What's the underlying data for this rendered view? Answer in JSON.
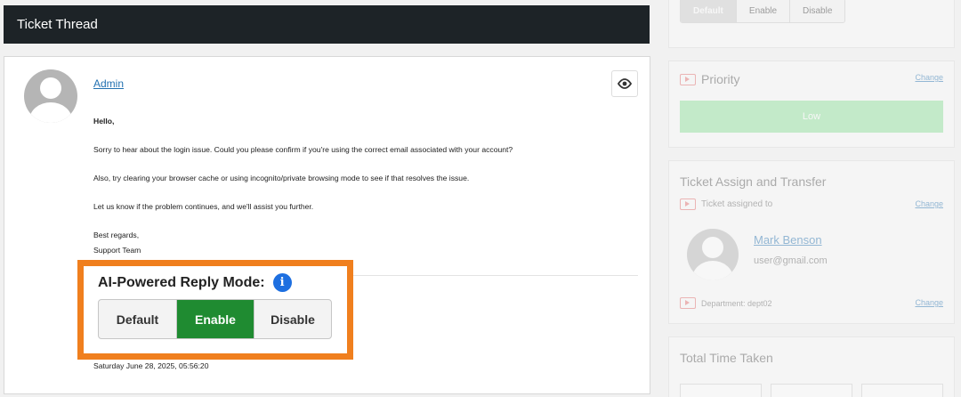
{
  "thread": {
    "header_title": "Ticket Thread",
    "author": "Admin",
    "greeting": "Hello,",
    "paragraphs": [
      "Sorry to hear about the login issue. Could you please confirm if you're using the correct email associated with your account?",
      "Also, try clearing your browser cache or using incognito/private browsing mode to see if that resolves the issue.",
      "Let us know if the problem continues, and we'll assist you further."
    ],
    "signoff": "Best regards,",
    "signature": "Support Team",
    "timestamp": "Saturday June 28, 2025, 05:56:20"
  },
  "ai_mode": {
    "title": "AI-Powered Reply Mode:",
    "info_icon": "info-icon",
    "options": [
      "Default",
      "Enable",
      "Disable"
    ],
    "selected": "Enable",
    "selected_color": "#1f8b31",
    "highlight_color": "#f07f1e"
  },
  "sidebar": {
    "mode_toggle": {
      "options": [
        "Default",
        "Enable",
        "Disable"
      ],
      "selected": "Default"
    },
    "priority": {
      "title": "Priority",
      "change_label": "Change",
      "value": "Low",
      "value_color": "#8de29a"
    },
    "assign": {
      "title": "Ticket Assign and Transfer",
      "assigned_label": "Ticket assigned to",
      "change_label": "Change",
      "agent_name": "Mark Benson",
      "agent_email": "user@gmail.com",
      "department_label": "Department: dept02",
      "department_change_label": "Change"
    },
    "time": {
      "title": "Total Time Taken"
    }
  }
}
